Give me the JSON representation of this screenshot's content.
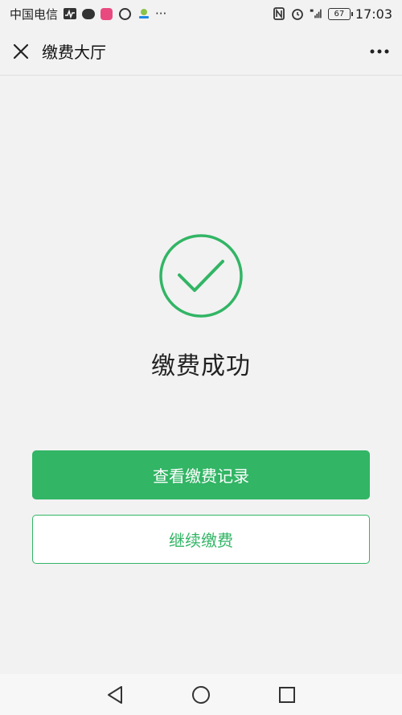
{
  "status_bar": {
    "carrier": "中国电信",
    "more": "···",
    "battery": "67",
    "time": "17:03"
  },
  "header": {
    "title": "缴费大厅"
  },
  "result": {
    "title": "缴费成功"
  },
  "actions": {
    "primary_label": "查看缴费记录",
    "secondary_label": "继续缴费"
  },
  "colors": {
    "accent": "#32b565",
    "background": "#f2f2f2"
  }
}
